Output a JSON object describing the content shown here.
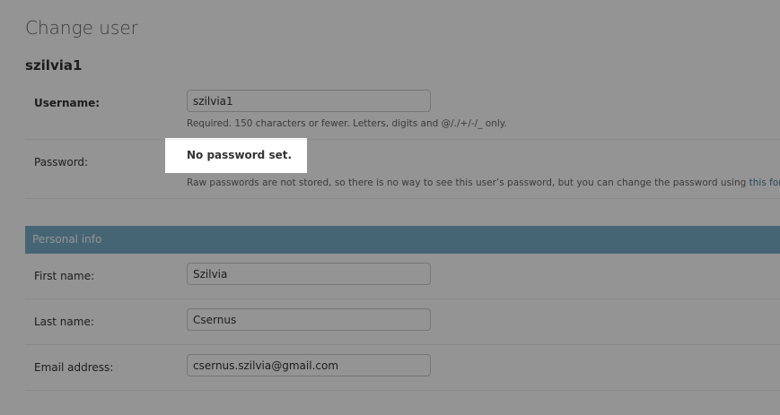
{
  "page": {
    "title": "Change user",
    "object_name": "szilvia1"
  },
  "auth": {
    "username_label": "Username:",
    "username_value": "szilvia1",
    "username_help": "Required. 150 characters or fewer. Letters, digits and @/./+/-/_ only.",
    "password_label": "Password:",
    "password_status": "No password set.",
    "password_help_prefix": "Raw passwords are not stored, so there is no way to see this user’s password, but you can change the password using ",
    "password_help_link": "this form",
    "password_help_suffix": "."
  },
  "personal_info": {
    "heading": "Personal info",
    "first_name_label": "First name:",
    "first_name_value": "Szilvia",
    "last_name_label": "Last name:",
    "last_name_value": "Csernus",
    "email_label": "Email address:",
    "email_value": "csernus.szilvia@gmail.com"
  },
  "colors": {
    "module_header": "#79aec8",
    "link": "#447e9b",
    "overlay": "rgba(0,0,0,0.42)"
  }
}
